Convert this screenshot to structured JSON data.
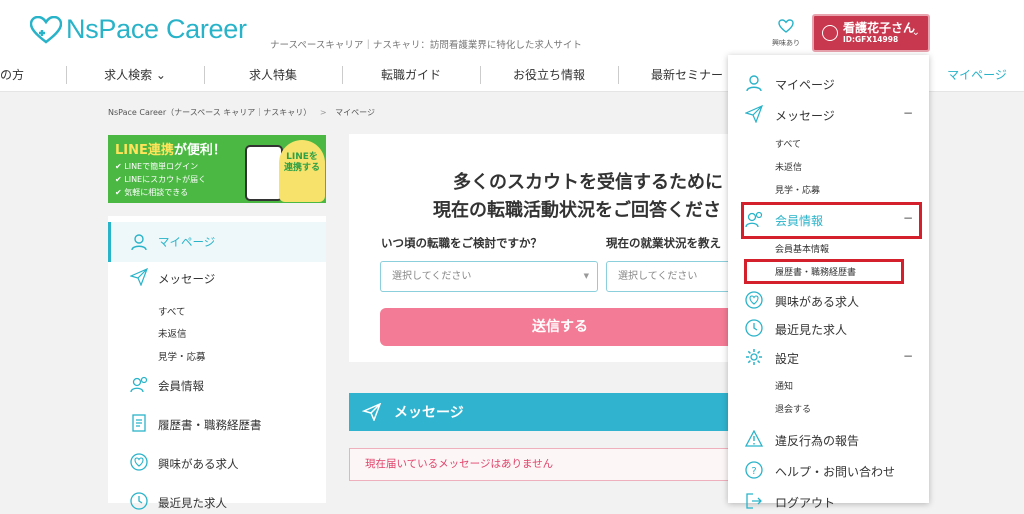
{
  "header": {
    "logo_text": "NsPace Career",
    "tagline": "ナースペースキャリア｜ナスキャリ：訪問看護業界に特化した求人サイト",
    "favorites_label": "興味あり",
    "user": {
      "name": "看護花子さん",
      "id": "ID:GFX14998"
    }
  },
  "nav": {
    "items": [
      "の方",
      "求人検索 ⌄",
      "求人特集",
      "転職ガイド",
      "お役立ち情報",
      "最新セミナー",
      "マイページ"
    ]
  },
  "breadcrumb": {
    "home": "NsPace Career（ナースペース キャリア｜ナスキャリ）",
    "sep": ">",
    "current": "マイページ"
  },
  "banner": {
    "title_a": "LINE連携",
    "title_b": "が便利！",
    "lines": [
      "LINEで簡単ログイン",
      "LINEにスカウトが届く",
      "気軽に相談できる"
    ],
    "badge": "LINEを\n連携する"
  },
  "sidebar": {
    "mypage": "マイページ",
    "message": "メッセージ",
    "message_subs": [
      "すべて",
      "未返信",
      "見学・応募"
    ],
    "member_info": "会員情報",
    "resume": "履歴書・職務経歴書",
    "interested": "興味がある求人",
    "recent": "最近見た求人"
  },
  "scout_card": {
    "heading_line1": "多くのスカウトを受信するために",
    "heading_line2": "現在の転職活動状況をご回答くださ",
    "q1": "いつ頃の転職をご検討ですか？",
    "q2": "現在の就業状況を教え",
    "select1_placeholder": "選択してください",
    "select2_placeholder": "選択してください",
    "submit_label": "送信する"
  },
  "messages": {
    "title": "メッセージ",
    "empty_text": "現在届いているメッセージはありません"
  },
  "dropdown": {
    "mypage": "マイページ",
    "message": "メッセージ",
    "message_subs": [
      "すべて",
      "未返信",
      "見学・応募"
    ],
    "member_info": "会員情報",
    "member_subs": [
      "会員基本情報",
      "履歴書・職務経歴書"
    ],
    "interested": "興味がある求人",
    "recent": "最近見た求人",
    "settings": "設定",
    "settings_subs": [
      "通知",
      "退会する"
    ],
    "report": "違反行為の報告",
    "help": "ヘルプ・お問い合わせ",
    "logout": "ログアウト",
    "collapse_symbol": "−"
  },
  "colors": {
    "brand": "#29b3c9",
    "user_button": "#c8384e",
    "submit": "#f47b95",
    "highlight_box": "#d4202c",
    "line_green": "#4bb843"
  }
}
